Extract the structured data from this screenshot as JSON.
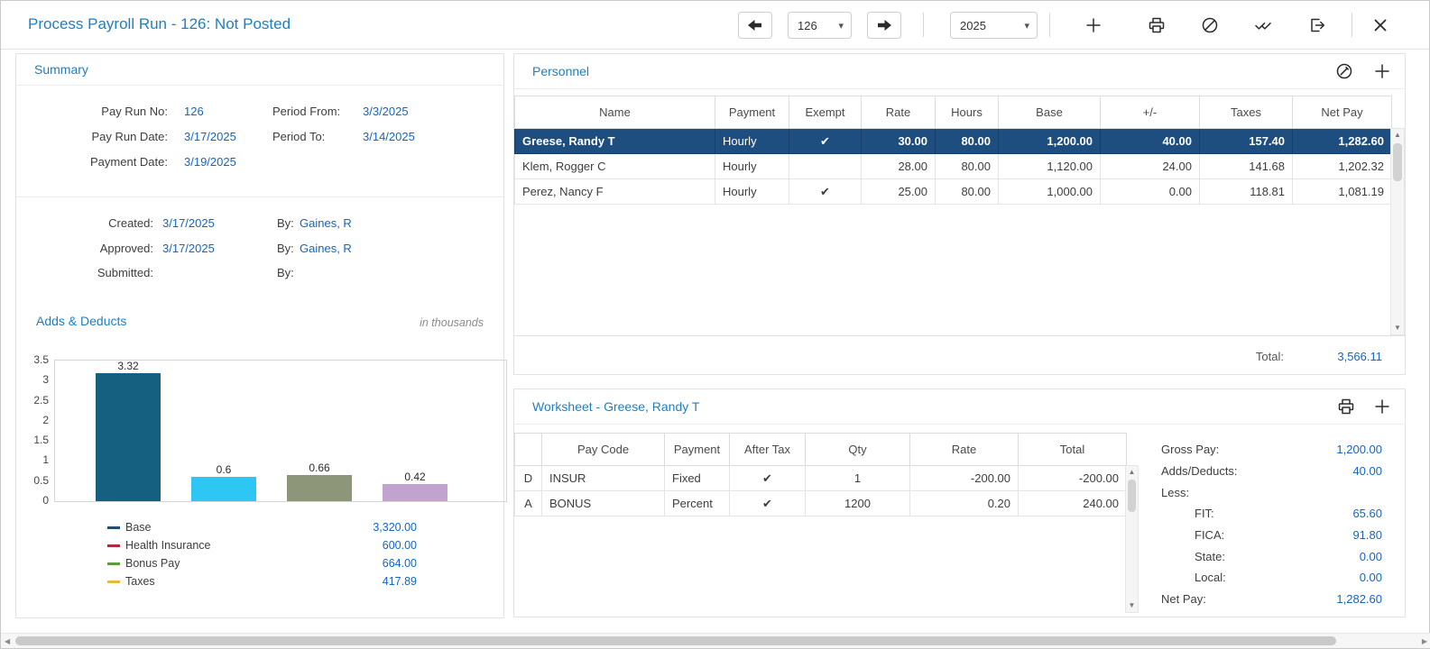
{
  "header": {
    "title": "Process Payroll Run - 126: Not Posted",
    "run_value": "126",
    "year_value": "2025"
  },
  "icons": {
    "caret_down": "▾",
    "up_arrow": "▲",
    "down_arrow": "▼",
    "left_arrow": "◀",
    "right_arrow": "▶"
  },
  "colors": {
    "accent_blue": "#1d7fc3",
    "link_blue": "#1565bf",
    "selected_row": "#1d4e7f",
    "check_green": "#3fa14f"
  },
  "summary": {
    "title": "Summary",
    "fields": [
      {
        "label": "Pay Run No:",
        "value": "126"
      },
      {
        "label": "Pay Run Date:",
        "value": "3/17/2025"
      },
      {
        "label": "Payment Date:",
        "value": "3/19/2025"
      },
      {
        "label": "Period From:",
        "value": "3/3/2025"
      },
      {
        "label": "Period To:",
        "value": "3/14/2025"
      }
    ],
    "audit": [
      {
        "label": "Created:",
        "date": "3/17/2025",
        "by_label": "By:",
        "by": "Gaines, R"
      },
      {
        "label": "Approved:",
        "date": "3/17/2025",
        "by_label": "By:",
        "by": "Gaines, R"
      },
      {
        "label": "Submitted:",
        "date": "",
        "by_label": "By:",
        "by": ""
      }
    ]
  },
  "chart_data": {
    "type": "bar",
    "title": "Adds & Deducts",
    "subtitle": "in thousands",
    "categories": [
      "Base",
      "Health Insurance",
      "Bonus Pay",
      "Taxes"
    ],
    "values": [
      3.32,
      0.6,
      0.66,
      0.42
    ],
    "bar_labels": [
      "3.32",
      "0.6",
      "0.66",
      "0.42"
    ],
    "bar_colors": [
      "#155f80",
      "#2ec6f2",
      "#8d9678",
      "#c2a3d0"
    ],
    "xlabel": "",
    "ylabel": "",
    "ylim": [
      0,
      3.5
    ],
    "yticks": [
      "3.5",
      "3",
      "2.5",
      "2",
      "1.5",
      "1",
      "0.5",
      "0"
    ],
    "grid": false,
    "legend_position": "bottom",
    "legend": [
      {
        "label": "Base",
        "color": "#1f4e79",
        "amount": "3,320.00"
      },
      {
        "label": "Health Insurance",
        "color": "#b02a3a",
        "amount": "600.00"
      },
      {
        "label": "Bonus Pay",
        "color": "#5a9e3c",
        "amount": "664.00"
      },
      {
        "label": "Taxes",
        "color": "#e6b83c",
        "amount": "417.89"
      }
    ]
  },
  "personnel": {
    "title": "Personnel",
    "columns": [
      "Name",
      "Payment",
      "Exempt",
      "Rate",
      "Hours",
      "Base",
      "+/-",
      "Taxes",
      "Net Pay"
    ],
    "rows": [
      {
        "name": "Greese, Randy T",
        "payment": "Hourly",
        "exempt": "✔",
        "rate": "30.00",
        "hours": "80.00",
        "base": "1,200.00",
        "plusminus": "40.00",
        "taxes": "157.40",
        "net": "1,282.60"
      },
      {
        "name": "Klem, Rogger C",
        "payment": "Hourly",
        "exempt": "",
        "rate": "28.00",
        "hours": "80.00",
        "base": "1,120.00",
        "plusminus": "24.00",
        "taxes": "141.68",
        "net": "1,202.32"
      },
      {
        "name": "Perez, Nancy F",
        "payment": "Hourly",
        "exempt": "✔",
        "rate": "25.00",
        "hours": "80.00",
        "base": "1,000.00",
        "plusminus": "0.00",
        "taxes": "118.81",
        "net": "1,081.19"
      }
    ],
    "total_label": "Total:",
    "total_value": "3,566.11"
  },
  "worksheet": {
    "title": "Worksheet - Greese, Randy T",
    "columns": [
      "",
      "Pay Code",
      "Payment",
      "After Tax",
      "Qty",
      "Rate",
      "Total"
    ],
    "rows": [
      {
        "type": "D",
        "pay_code": "INSUR",
        "payment": "Fixed",
        "after_tax": "✔",
        "qty": "1",
        "rate": "-200.00",
        "total": "-200.00"
      },
      {
        "type": "A",
        "pay_code": "BONUS",
        "payment": "Percent",
        "after_tax": "✔",
        "qty": "1200",
        "rate": "0.20",
        "total": "240.00"
      }
    ],
    "totals": {
      "gross_label": "Gross Pay:",
      "gross": "1,200.00",
      "adds_label": "Adds/Deducts:",
      "adds": "40.00",
      "less_label": "Less:",
      "fit_label": "FIT:",
      "fit": "65.60",
      "fica_label": "FICA:",
      "fica": "91.80",
      "state_label": "State:",
      "state": "0.00",
      "local_label": "Local:",
      "local": "0.00",
      "net_label": "Net Pay:",
      "net": "1,282.60"
    }
  }
}
